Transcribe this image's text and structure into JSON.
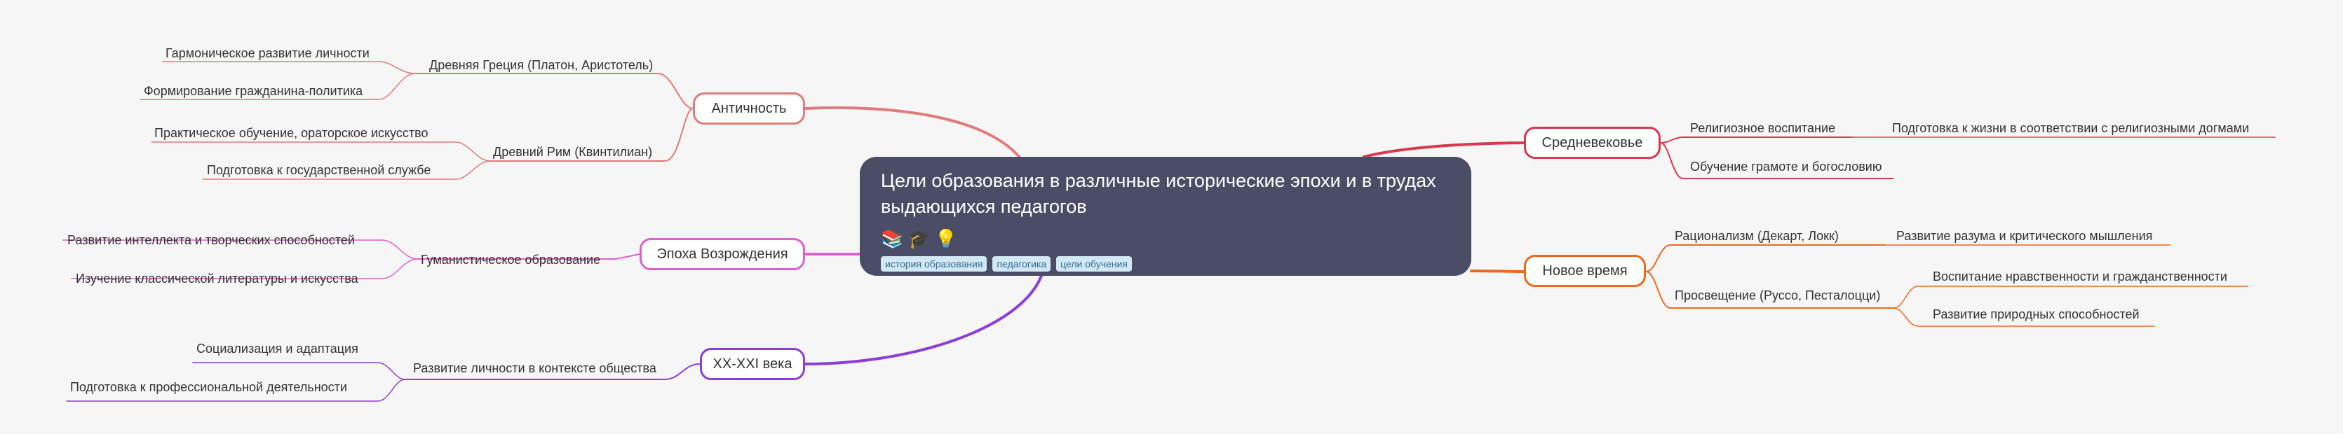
{
  "central": {
    "title_line1": "Цели образования в различные исторические эпохи и в трудах",
    "title_line2": "выдающихся педагогов",
    "icons": [
      "📚",
      "🎓",
      "💡"
    ],
    "tags": [
      "история образования",
      "педагогика",
      "цели обучения"
    ]
  },
  "branches": {
    "antiquity": {
      "label": "Античность",
      "color": "#e07b7b",
      "greece": {
        "label": "Древняя Греция (Платон, Аристотель)",
        "leaves": [
          "Гармоническое развитие личности",
          "Формирование гражданина-политика"
        ]
      },
      "rome": {
        "label": "Древний Рим (Квинтилиан)",
        "leaves": [
          "Практическое обучение, ораторское искусство",
          "Подготовка к государственной службе"
        ]
      }
    },
    "renaissance": {
      "label": "Эпоха Возрождения",
      "color": "#de5fcf",
      "humanism": {
        "label": "Гуманистическое образование",
        "leaves": [
          "Развитие интеллекта и творческих способностей",
          "Изучение классической литературы и искусства"
        ]
      }
    },
    "modern_century": {
      "label": "XX-XXI века",
      "color": "#8b3fd6",
      "society": {
        "label": "Развитие личности в контексте общества",
        "leaves": [
          "Социализация и адаптация",
          "Подготовка к профессиональной деятельности"
        ]
      }
    },
    "middle_ages": {
      "label": "Средневековье",
      "color": "#d63a4e",
      "religious": {
        "label": "Религиозное воспитание",
        "leaves": [
          "Подготовка к жизни в соответствии с религиозными догмами"
        ]
      },
      "literacy": {
        "label": "Обучение грамоте и богословию"
      }
    },
    "new_time": {
      "label": "Новое время",
      "color": "#ec6a1c",
      "rationalism": {
        "label": "Рационализм (Декарт, Локк)",
        "leaves": [
          "Развитие разума и критического мышления"
        ]
      },
      "enlightenment": {
        "label": "Просвещение (Руссо, Песталоцци)",
        "leaves": [
          "Воспитание нравственности и гражданственности",
          "Развитие природных способностей"
        ]
      }
    }
  }
}
